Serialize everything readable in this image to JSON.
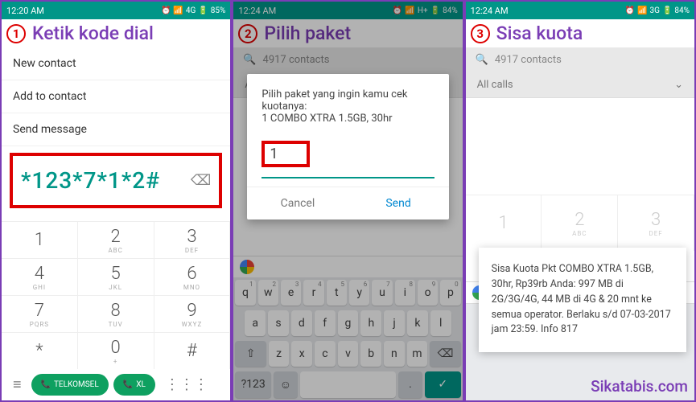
{
  "p1": {
    "time": "12:20 AM",
    "status_net": "4G",
    "status_batt": "85%",
    "step": "1",
    "title": "Ketik kode dial",
    "menu1": "New contact",
    "menu2": "Add to contact",
    "menu3": "Send message",
    "dial": "*123*7*1*2#",
    "keys": [
      {
        "n": "1",
        "s": ""
      },
      {
        "n": "2",
        "s": "ABC"
      },
      {
        "n": "3",
        "s": "DEF"
      },
      {
        "n": "4",
        "s": "GHI"
      },
      {
        "n": "5",
        "s": "JKL"
      },
      {
        "n": "6",
        "s": "MNO"
      },
      {
        "n": "7",
        "s": "PQRS"
      },
      {
        "n": "8",
        "s": "TUV"
      },
      {
        "n": "9",
        "s": "WXYZ"
      },
      {
        "n": "*",
        "s": ""
      },
      {
        "n": "0",
        "s": "+"
      },
      {
        "n": "#",
        "s": ""
      }
    ],
    "call1": "TELKOMSEL",
    "call2": "XL"
  },
  "p2": {
    "time": "12:24 AM",
    "status_net": "H+",
    "status_batt": "84%",
    "step": "2",
    "title": "Pilih paket",
    "search": "4917 contacts",
    "filter": "All calls",
    "dialog_line1": "Pilih paket yang ingin kamu cek kuotanya:",
    "dialog_line2": "1 COMBO XTRA 1.5GB, 30hr",
    "input_val": "1",
    "cancel": "Cancel",
    "send": "Send",
    "kb_r1": [
      {
        "k": "q",
        "s": "1"
      },
      {
        "k": "w",
        "s": "2"
      },
      {
        "k": "e",
        "s": "3"
      },
      {
        "k": "r",
        "s": "4"
      },
      {
        "k": "t",
        "s": "5"
      },
      {
        "k": "y",
        "s": "6"
      },
      {
        "k": "u",
        "s": "7"
      },
      {
        "k": "i",
        "s": "8"
      },
      {
        "k": "o",
        "s": "9"
      },
      {
        "k": "p",
        "s": "0"
      }
    ],
    "kb_r2": [
      {
        "k": "a"
      },
      {
        "k": "s"
      },
      {
        "k": "d"
      },
      {
        "k": "f"
      },
      {
        "k": "g"
      },
      {
        "k": "h"
      },
      {
        "k": "j"
      },
      {
        "k": "k"
      },
      {
        "k": "l"
      }
    ],
    "kb_r3": [
      {
        "k": "z"
      },
      {
        "k": "x"
      },
      {
        "k": "c"
      },
      {
        "k": "v"
      },
      {
        "k": "b"
      },
      {
        "k": "n"
      },
      {
        "k": "m"
      }
    ],
    "kb_sym": "?123"
  },
  "p3": {
    "time": "12:24 AM",
    "status_net": "3G",
    "status_batt": "84%",
    "step": "3",
    "title": "Sisa kuota",
    "search": "4917 contacts",
    "filter": "All calls",
    "keys": [
      {
        "n": "1",
        "s": ""
      },
      {
        "n": "2",
        "s": "ABC"
      },
      {
        "n": "3",
        "s": "DEF"
      }
    ],
    "toast": "Sisa Kuota Pkt  COMBO XTRA 1.5GB, 30hr, Rp39rb Anda: 997 MB di 2G/3G/4G,  44 MB di 4G & 20 mnt  ke semua operator. Berlaku s/d 07-03-2017 jam 23:59. Info 817",
    "watermark": "Sikatabis.com"
  }
}
